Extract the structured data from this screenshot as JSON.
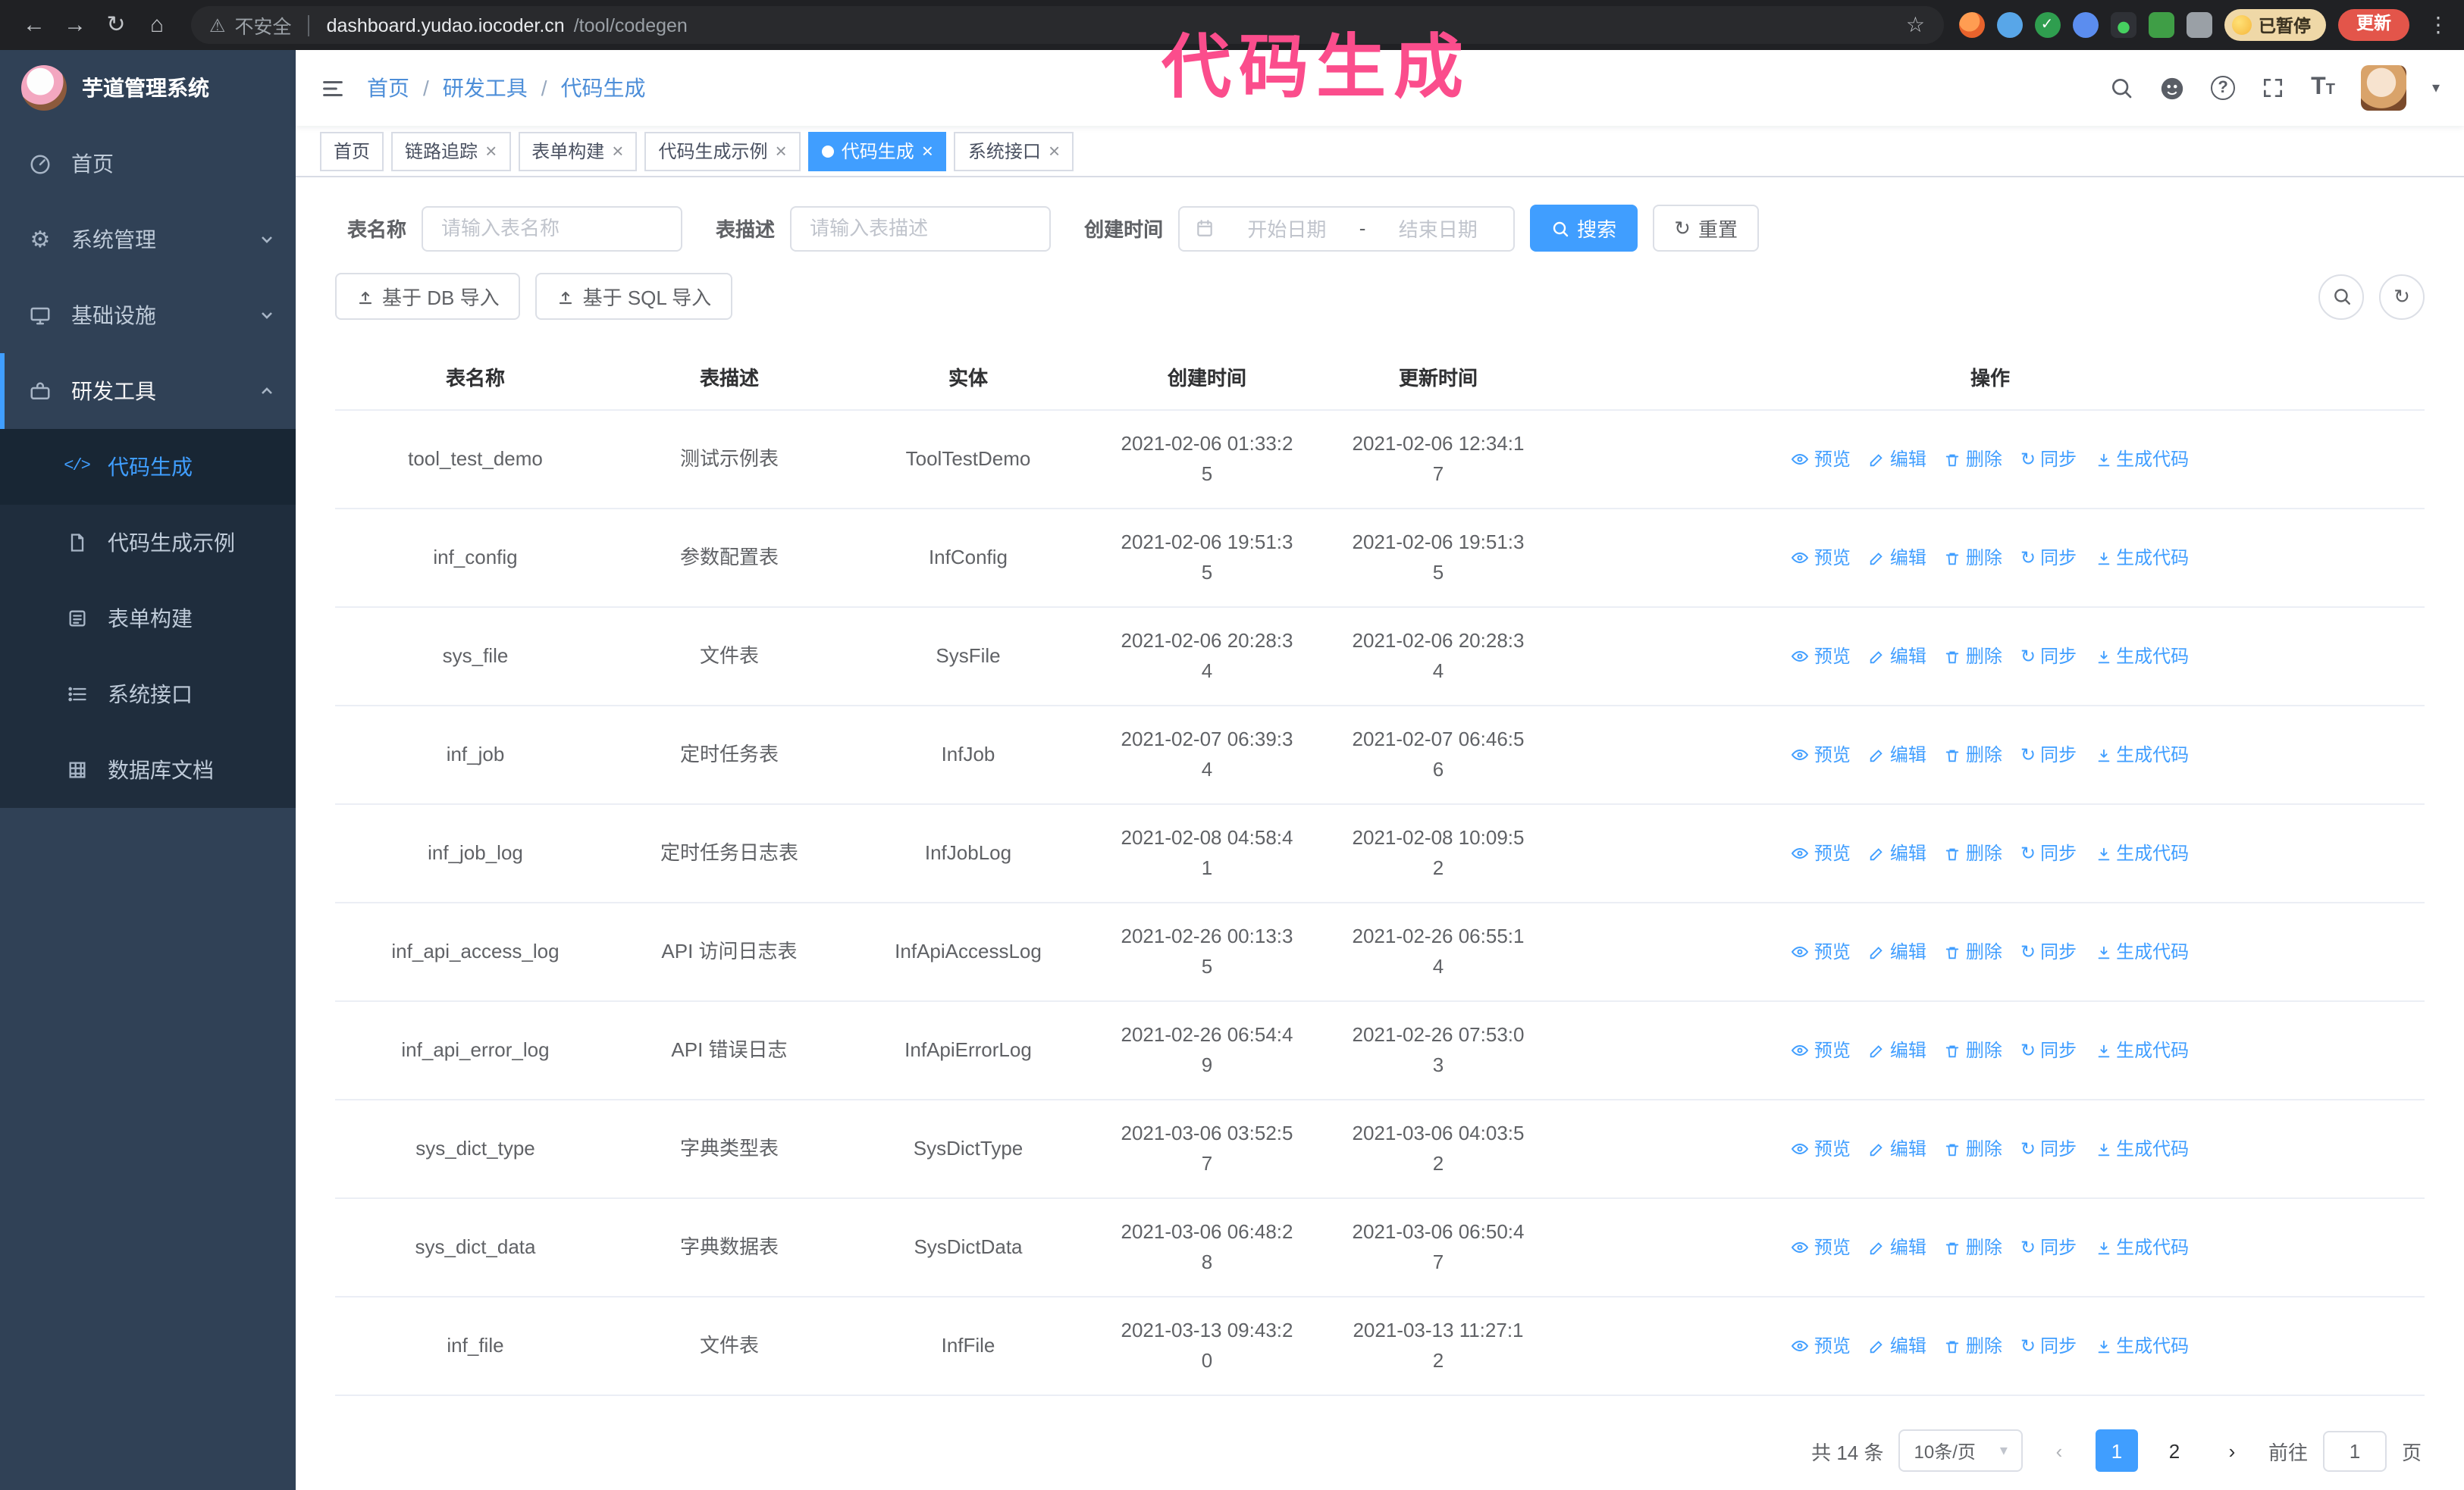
{
  "colors": {
    "primary": "#409eff",
    "active_tab_blue": "#409eff",
    "sidebar_bg": "#304156",
    "submenu_bg": "#1f2d3d",
    "annotation_pink": "#fb4d8c",
    "update_button_red": "#e3554a"
  },
  "icons": {
    "back": "←",
    "forward": "→",
    "reload": "↻",
    "home": "⌂",
    "warning": "⚠",
    "star": "☆",
    "browser_menu": "⋮",
    "gear": "⚙",
    "caret_down": "▾",
    "close": "×",
    "sync": "↻",
    "prev": "‹",
    "next": "›",
    "code": "</>",
    "check": "✓",
    "question": "?",
    "text_size": "T"
  },
  "browser": {
    "security_label": "不安全",
    "url_host": "dashboard.yudao.iocoder.cn",
    "url_path": "/tool/codegen",
    "paused_badge": "已暂停",
    "update_button": "更新"
  },
  "annotation": {
    "text": "代码生成"
  },
  "sidebar": {
    "logo_title": "芋道管理系统",
    "items": [
      {
        "label": "首页"
      },
      {
        "label": "系统管理"
      },
      {
        "label": "基础设施"
      },
      {
        "label": "研发工具"
      }
    ],
    "submenu": [
      {
        "label": "代码生成",
        "active": true
      },
      {
        "label": "代码生成示例"
      },
      {
        "label": "表单构建"
      },
      {
        "label": "系统接口"
      },
      {
        "label": "数据库文档"
      }
    ]
  },
  "topbar": {
    "breadcrumb": [
      "首页",
      "研发工具",
      "代码生成"
    ],
    "breadcrumb_separator": "/"
  },
  "tabs": [
    {
      "label": "首页"
    },
    {
      "label": "链路追踪",
      "closable": true
    },
    {
      "label": "表单构建",
      "closable": true
    },
    {
      "label": "代码生成示例",
      "closable": true
    },
    {
      "label": "代码生成",
      "closable": true,
      "active": true
    },
    {
      "label": "系统接口",
      "closable": true
    }
  ],
  "filters": {
    "table_name_label": "表名称",
    "table_name_placeholder": "请输入表名称",
    "table_desc_label": "表描述",
    "table_desc_placeholder": "请输入表描述",
    "create_time_label": "创建时间",
    "date_start_placeholder": "开始日期",
    "date_separator": "-",
    "date_end_placeholder": "结束日期",
    "search_button": "搜索",
    "reset_button": "重置"
  },
  "toolbar": {
    "import_db": "基于 DB 导入",
    "import_sql": "基于 SQL 导入"
  },
  "table": {
    "columns": [
      "表名称",
      "表描述",
      "实体",
      "创建时间",
      "更新时间",
      "操作"
    ],
    "actions": [
      "预览",
      "编辑",
      "删除",
      "同步",
      "生成代码"
    ],
    "rows": [
      {
        "name": "tool_test_demo",
        "desc": "测试示例表",
        "entity": "ToolTestDemo",
        "created": "2021-02-06 01:33:25",
        "updated": "2021-02-06 12:34:17"
      },
      {
        "name": "inf_config",
        "desc": "参数配置表",
        "entity": "InfConfig",
        "created": "2021-02-06 19:51:35",
        "updated": "2021-02-06 19:51:35"
      },
      {
        "name": "sys_file",
        "desc": "文件表",
        "entity": "SysFile",
        "created": "2021-02-06 20:28:34",
        "updated": "2021-02-06 20:28:34"
      },
      {
        "name": "inf_job",
        "desc": "定时任务表",
        "entity": "InfJob",
        "created": "2021-02-07 06:39:34",
        "updated": "2021-02-07 06:46:56"
      },
      {
        "name": "inf_job_log",
        "desc": "定时任务日志表",
        "entity": "InfJobLog",
        "created": "2021-02-08 04:58:41",
        "updated": "2021-02-08 10:09:52"
      },
      {
        "name": "inf_api_access_log",
        "desc": "API 访问日志表",
        "entity": "InfApiAccessLog",
        "created": "2021-02-26 00:13:35",
        "updated": "2021-02-26 06:55:14"
      },
      {
        "name": "inf_api_error_log",
        "desc": "API 错误日志",
        "entity": "InfApiErrorLog",
        "created": "2021-02-26 06:54:49",
        "updated": "2021-02-26 07:53:03"
      },
      {
        "name": "sys_dict_type",
        "desc": "字典类型表",
        "entity": "SysDictType",
        "created": "2021-03-06 03:52:57",
        "updated": "2021-03-06 04:03:52"
      },
      {
        "name": "sys_dict_data",
        "desc": "字典数据表",
        "entity": "SysDictData",
        "created": "2021-03-06 06:48:28",
        "updated": "2021-03-06 06:50:47"
      },
      {
        "name": "inf_file",
        "desc": "文件表",
        "entity": "InfFile",
        "created": "2021-03-13 09:43:20",
        "updated": "2021-03-13 11:27:12"
      }
    ]
  },
  "pagination": {
    "total_text": "共 14 条",
    "page_size": "10条/页",
    "pages": [
      {
        "label": "1",
        "active": true
      },
      {
        "label": "2"
      }
    ],
    "goto_label": "前往",
    "goto_value": "1",
    "goto_suffix": "页"
  }
}
